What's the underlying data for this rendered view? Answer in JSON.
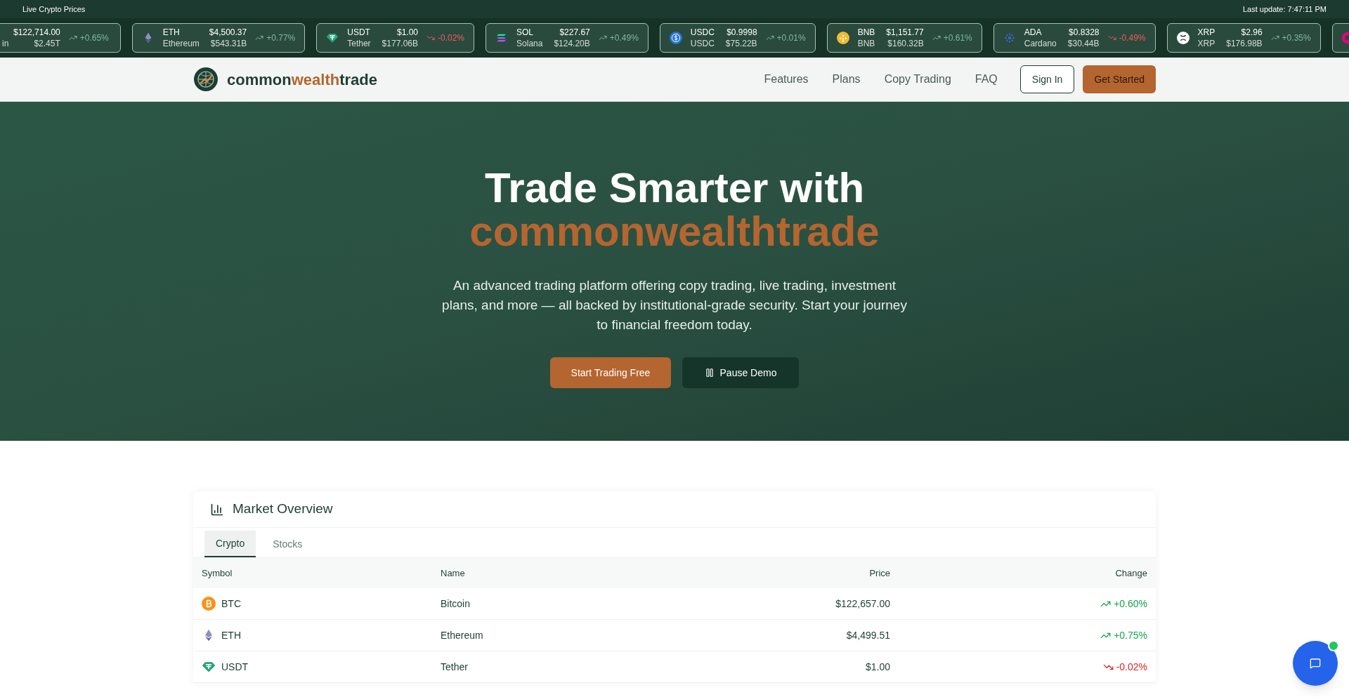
{
  "ticker": {
    "title": "Live Crypto Prices",
    "last_update": "Last update: 7:47:11 PM",
    "cards": [
      {
        "name": "in",
        "price": "$122,714.00",
        "cap": "$2.45T",
        "change": "+0.65%",
        "rising": true
      },
      {
        "kind": "eth",
        "symbol": "ETH",
        "name": "Ethereum",
        "price": "$4,500.37",
        "cap": "$543.31B",
        "change": "+0.77%",
        "rising": true
      },
      {
        "kind": "usdt",
        "symbol": "USDT",
        "name": "Tether",
        "price": "$1.00",
        "cap": "$177.06B",
        "change": "-0.02%",
        "rising": false
      },
      {
        "kind": "sol",
        "symbol": "SOL",
        "name": "Solana",
        "price": "$227.67",
        "cap": "$124.20B",
        "change": "+0.49%",
        "rising": true
      },
      {
        "kind": "usdc",
        "symbol": "USDC",
        "name": "USDC",
        "price": "$0.9998",
        "cap": "$75.22B",
        "change": "+0.01%",
        "rising": true
      },
      {
        "kind": "bnb",
        "symbol": "BNB",
        "name": "BNB",
        "price": "$1,151.77",
        "cap": "$160.32B",
        "change": "+0.61%",
        "rising": true
      },
      {
        "kind": "ada",
        "symbol": "ADA",
        "name": "Cardano",
        "price": "$0.8328",
        "cap": "$30.44B",
        "change": "-0.49%",
        "rising": false
      },
      {
        "kind": "xrp",
        "symbol": "XRP",
        "name": "XRP",
        "price": "$2.96",
        "cap": "$176.98B",
        "change": "+0.35%",
        "rising": true
      }
    ]
  },
  "nav": {
    "logo_parts": [
      "common",
      "wealth",
      "trade"
    ],
    "links": [
      "Features",
      "Plans",
      "Copy Trading",
      "FAQ"
    ],
    "sign_in": "Sign In",
    "get_started": "Get Started"
  },
  "hero": {
    "title": "Trade Smarter with",
    "brand": "commonwealthtrade",
    "text": "An advanced trading platform offering copy trading, live trading, investment plans, and more — all backed by institutional-grade security. Start your journey to financial freedom today.",
    "primary_button": "Start Trading Free",
    "secondary_button": "Pause Demo"
  },
  "market": {
    "title": "Market Overview",
    "tabs": [
      {
        "label": "Crypto",
        "selected": true
      },
      {
        "label": "Stocks",
        "selected": false
      }
    ],
    "columns": [
      "Symbol",
      "Name",
      "Price",
      "Change"
    ],
    "rows": [
      {
        "kind": "btc",
        "symbol": "BTC",
        "name": "Bitcoin",
        "price": "$122,657.00",
        "change": "+0.60%",
        "rising": true
      },
      {
        "kind": "eth",
        "symbol": "ETH",
        "name": "Ethereum",
        "price": "$4,499.51",
        "change": "+0.75%",
        "rising": true
      },
      {
        "kind": "usdt",
        "symbol": "USDT",
        "name": "Tether",
        "price": "$1.00",
        "change": "-0.02%",
        "rising": false
      }
    ]
  },
  "chat": {
    "online": true
  }
}
